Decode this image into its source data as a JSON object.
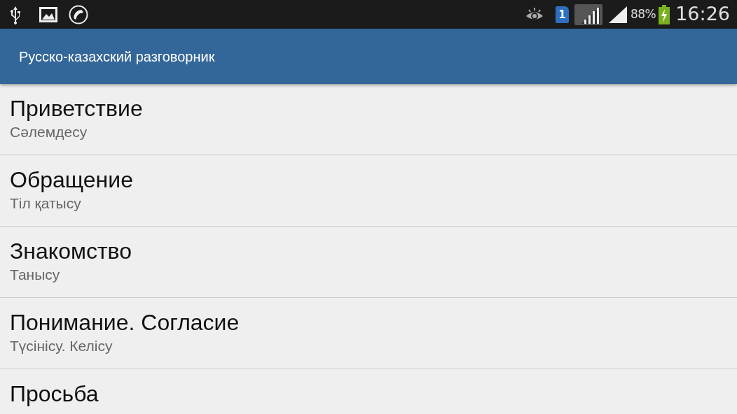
{
  "status_bar": {
    "sim_number": "1",
    "battery_percent": "88%",
    "time": "16:26"
  },
  "app_bar": {
    "title": "Русско-казахский разговорник"
  },
  "items": [
    {
      "title": "Приветствие",
      "subtitle": "Сәлемдесу"
    },
    {
      "title": "Обращение",
      "subtitle": "Тіл қатысу"
    },
    {
      "title": "Знакомство",
      "subtitle": "Танысу"
    },
    {
      "title": "Понимание. Согласие",
      "subtitle": "Түсінісу. Келісу"
    },
    {
      "title": "Просьба"
    }
  ]
}
